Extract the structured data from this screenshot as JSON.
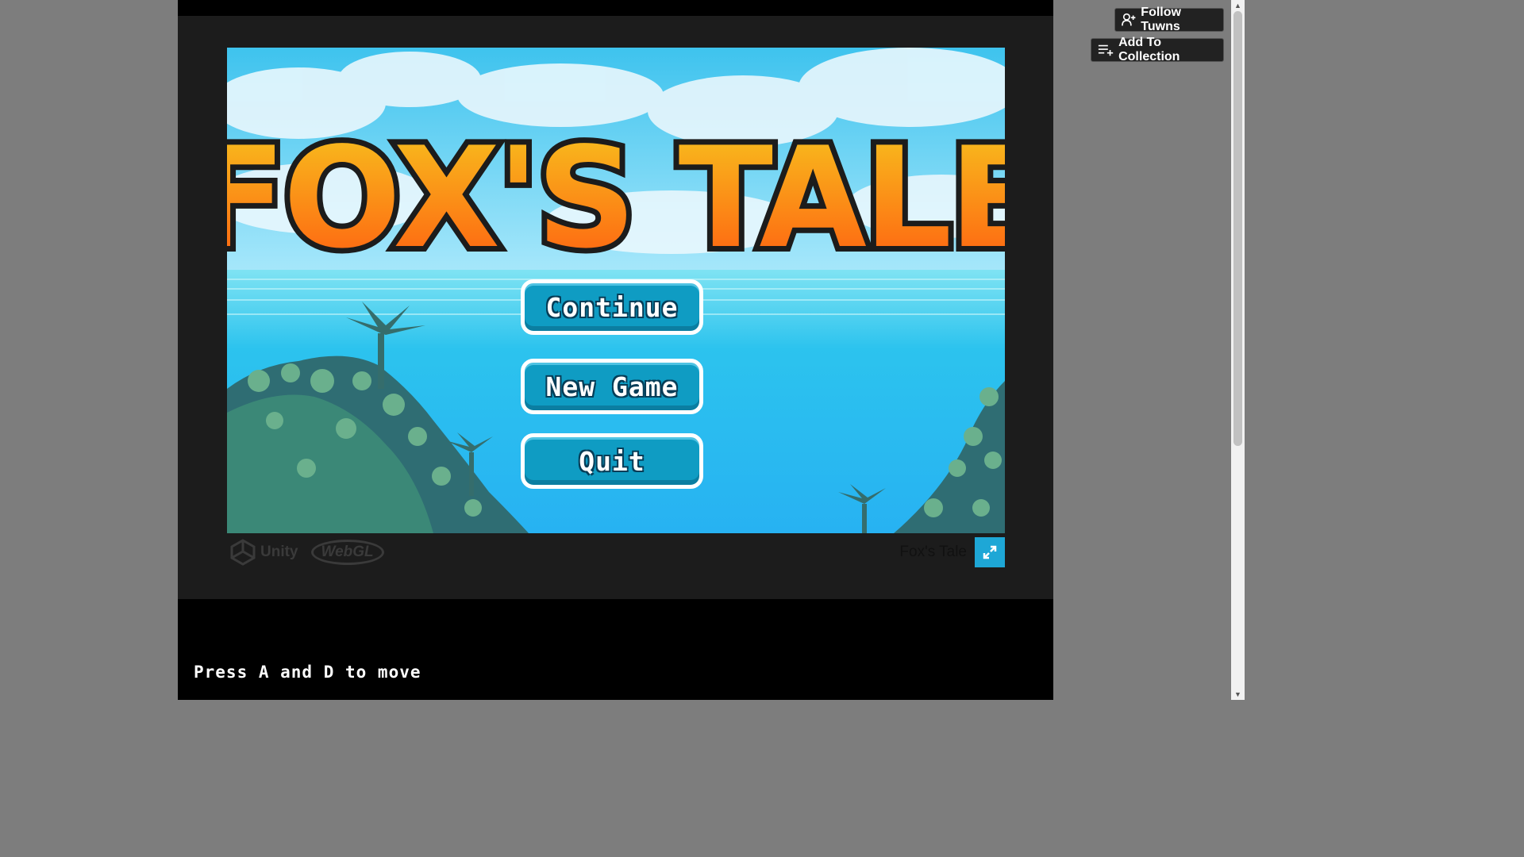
{
  "game": {
    "title_logo": "FOX'S TALE",
    "menu": [
      {
        "label": "Continue"
      },
      {
        "label": "New Game"
      },
      {
        "label": "Quit"
      }
    ]
  },
  "footer": {
    "unity_label": "Unity",
    "webgl_label": "WebGL",
    "game_name": "Fox's Tale",
    "fullscreen_icon": "expand-icon"
  },
  "hint": "Press A and D to move",
  "sidebar": {
    "follow_label": "Follow Tuwns",
    "collection_label": "Add To Collection"
  },
  "colors": {
    "accent": "#1ea7d6",
    "button": "#0f9cc3",
    "title_top": "#f7c51e",
    "title_bottom": "#ff5a10"
  }
}
